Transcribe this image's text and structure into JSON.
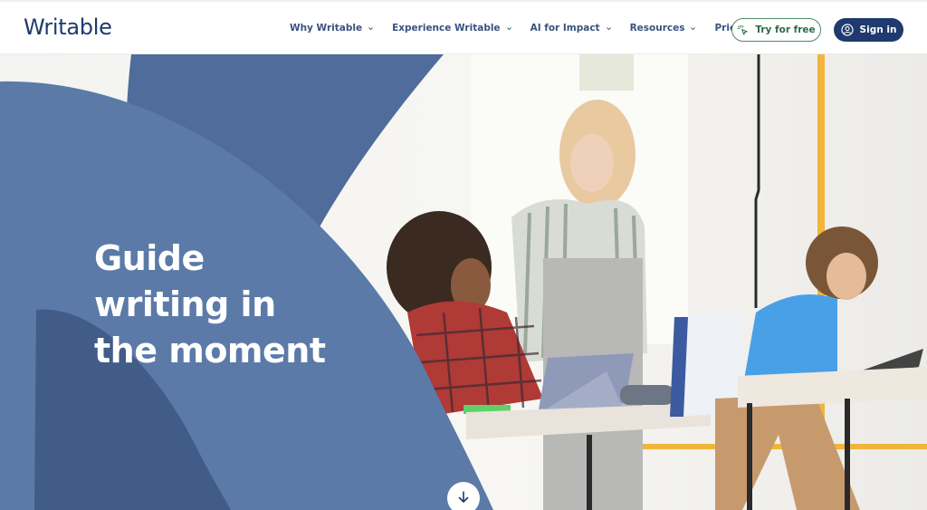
{
  "header": {
    "logo": "Writable",
    "nav": [
      {
        "label": "Why Writable",
        "icon": "chevron-down-icon"
      },
      {
        "label": "Experience Writable",
        "icon": "chevron-down-icon"
      },
      {
        "label": "AI for Impact",
        "icon": "chevron-down-icon"
      },
      {
        "label": "Resources",
        "icon": "chevron-down-icon"
      },
      {
        "label": "Pricing",
        "icon": "chevron-down-icon"
      }
    ],
    "try_button": {
      "label": "Try for free",
      "icon": "cursor-click-icon"
    },
    "sign_in_button": {
      "label": "Sign in",
      "icon": "user-circle-icon"
    }
  },
  "hero": {
    "headline_lines": [
      "Guide",
      "writing in",
      "the moment"
    ],
    "image_alt": "Teacher helping students writing on tablets in a classroom",
    "scroll_button": {
      "icon": "arrow-down-icon"
    }
  },
  "colors": {
    "brand_navy": "#1e3a6e",
    "nav_text": "#3a5280",
    "try_green": "#2f6b4a",
    "shape_blue": "#5b7aa8",
    "shape_dark": "#3f5a86"
  }
}
